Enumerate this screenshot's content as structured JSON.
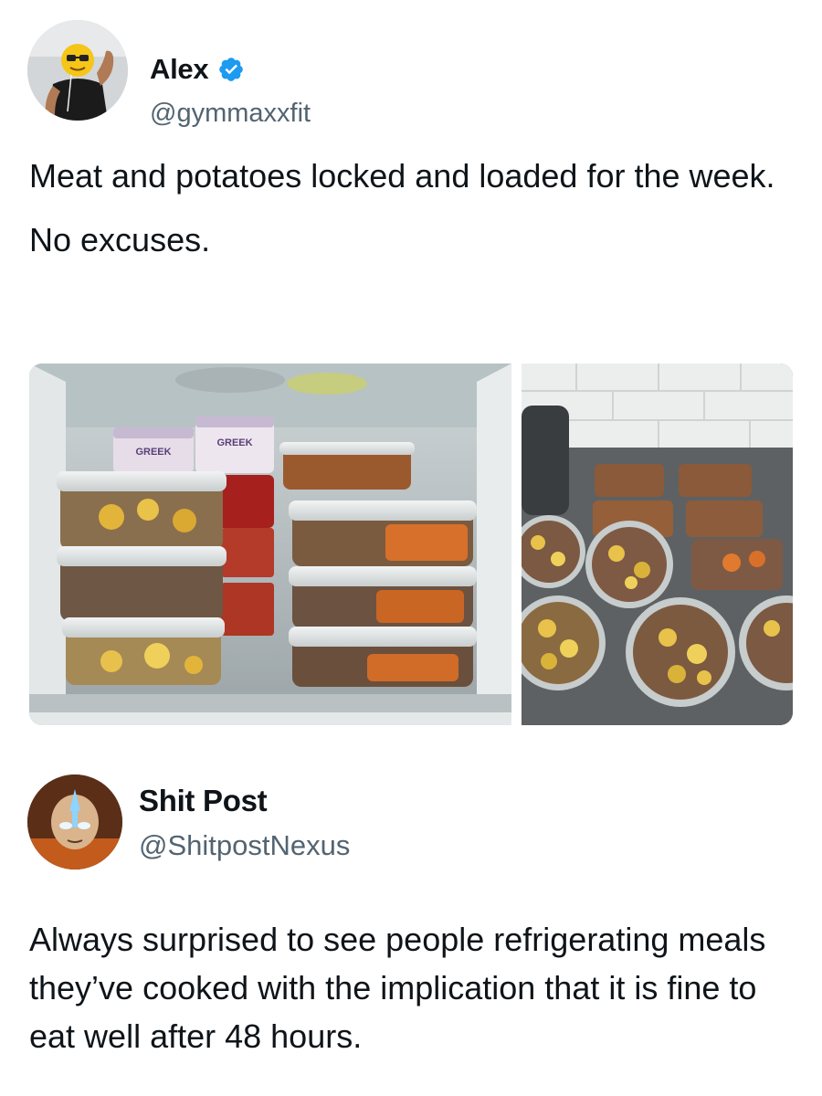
{
  "tweets": [
    {
      "author": {
        "name": "Alex",
        "handle": "@gymmaxxfit",
        "verified": true
      },
      "text_paragraphs": [
        "Meat and potatoes locked and loaded for the week.",
        "No excuses."
      ],
      "media": [
        {
          "subject": "open refrigerator with stacked glass meal-prep containers of mince and potatoes"
        },
        {
          "subject": "tray of glass meal-prep bowls with mince and roasted potatoes on a countertop"
        }
      ]
    },
    {
      "author": {
        "name": "Shit Post",
        "handle": "@ShitpostNexus"
      },
      "text": "Always surprised to see people refrigerating meals they’ve cooked with the implication that it is fine to eat well after 48 hours."
    }
  ],
  "labels": {
    "greek_1": "GREEK",
    "greek_2": "GREEK"
  },
  "colors": {
    "verified_blue": "#1d9bf0",
    "handle_gray": "#536471",
    "text_primary": "#0f1419"
  },
  "icons": {
    "verified": "verified-badge-icon"
  }
}
